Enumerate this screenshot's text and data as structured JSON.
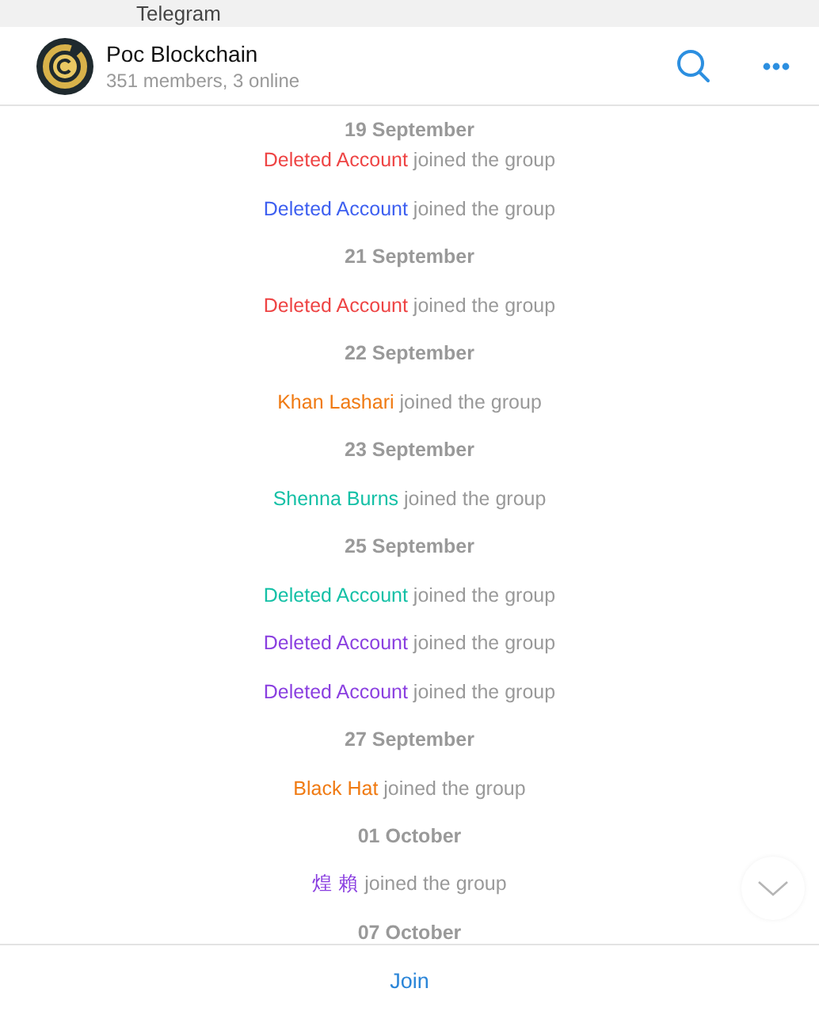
{
  "window": {
    "title": "Telegram"
  },
  "chat": {
    "name": "Poc Blockchain",
    "status": "351 members, 3 online"
  },
  "messages": [
    {
      "kind": "date",
      "text": "19 September"
    },
    {
      "kind": "join",
      "name": "Deleted Account",
      "color": "#ee4444",
      "text": "joined the group"
    },
    {
      "kind": "join",
      "name": "Deleted Account",
      "color": "#3d5ff0",
      "text": "joined the group"
    },
    {
      "kind": "date",
      "text": "21 September"
    },
    {
      "kind": "join",
      "name": "Deleted Account",
      "color": "#ee4444",
      "text": "joined the group"
    },
    {
      "kind": "date",
      "text": "22 September"
    },
    {
      "kind": "join",
      "name": "Khan Lashari",
      "color": "#f07a12",
      "text": "joined the group"
    },
    {
      "kind": "date",
      "text": "23 September"
    },
    {
      "kind": "join",
      "name": "Shenna Burns",
      "color": "#14c0a6",
      "text": "joined the group"
    },
    {
      "kind": "date",
      "text": "25 September"
    },
    {
      "kind": "join",
      "name": "Deleted Account",
      "color": "#14c0a6",
      "text": "joined the group"
    },
    {
      "kind": "join",
      "name": "Deleted Account",
      "color": "#8a3fe0",
      "text": "joined the group"
    },
    {
      "kind": "join",
      "name": "Deleted Account",
      "color": "#8a3fe0",
      "text": "joined the group"
    },
    {
      "kind": "date",
      "text": "27 September"
    },
    {
      "kind": "join",
      "name": "Black Hat",
      "color": "#f07a12",
      "text": "joined the group"
    },
    {
      "kind": "date",
      "text": "01 October"
    },
    {
      "kind": "join",
      "name": "煌 賴",
      "color": "#8a3fe0",
      "text": "joined the group"
    },
    {
      "kind": "date",
      "text": "07 October"
    }
  ],
  "footer": {
    "button": "Join"
  }
}
